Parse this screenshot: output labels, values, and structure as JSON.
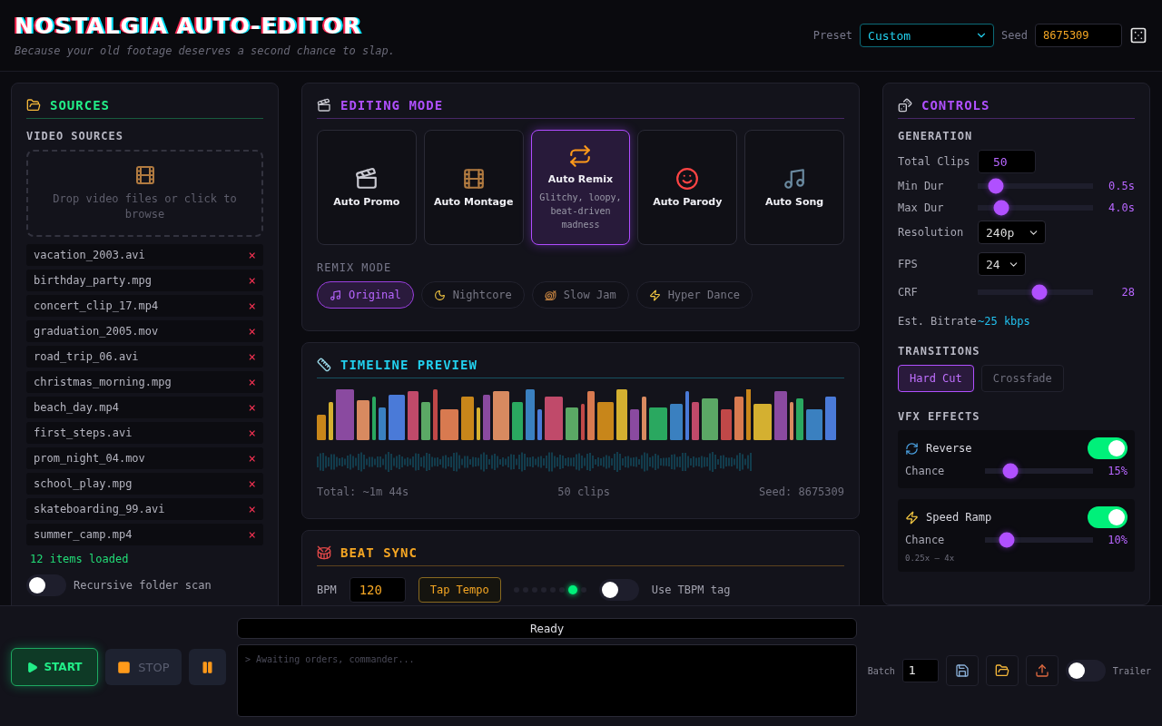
{
  "header": {
    "title": "NOSTALGIA AUTO-EDITOR",
    "subtitle": "Because your old footage deserves a second chance to slap.",
    "preset": {
      "label": "Preset",
      "value": "Custom"
    },
    "seed": {
      "label": "Seed",
      "value": "8675309"
    }
  },
  "sources": {
    "title": "SOURCES",
    "section": "VIDEO SOURCES",
    "dropzone": "Drop video files or click to browse",
    "files": [
      "vacation_2003.avi",
      "birthday_party.mpg",
      "concert_clip_17.mp4",
      "graduation_2005.mov",
      "road_trip_06.avi",
      "christmas_morning.mpg",
      "beach_day.mp4",
      "first_steps.avi",
      "prom_night_04.mov",
      "school_play.mpg",
      "skateboarding_99.avi",
      "summer_camp.mp4"
    ],
    "remove_mark": "×",
    "status": "12 items loaded",
    "recursive": {
      "label": "Recursive folder scan",
      "on": false
    }
  },
  "editing_mode": {
    "title": "EDITING MODE",
    "modes": [
      {
        "kind": "promo",
        "label": "Auto Promo",
        "selected": false
      },
      {
        "kind": "montage",
        "label": "Auto Montage",
        "selected": false
      },
      {
        "kind": "remix",
        "label": "Auto Remix",
        "description": "Glitchy, loopy, beat-driven madness",
        "selected": true
      },
      {
        "kind": "parody",
        "label": "Auto Parody",
        "selected": false
      },
      {
        "kind": "song",
        "label": "Auto Song",
        "selected": false
      }
    ],
    "remix_label": "REMIX MODE",
    "remix_options": [
      {
        "kind": "original",
        "label": "Original",
        "selected": true
      },
      {
        "kind": "nightcore",
        "label": "Nightcore",
        "selected": false
      },
      {
        "kind": "slow",
        "label": "Slow Jam",
        "selected": false
      },
      {
        "kind": "hyper",
        "label": "Hyper Dance",
        "selected": false
      }
    ]
  },
  "timeline": {
    "title": "TIMELINE PREVIEW",
    "total": "Total: ~1m 44s",
    "clips": "50 clips",
    "seed": "Seed: 8675309"
  },
  "beat_sync": {
    "title": "BEAT SYNC",
    "bpm_label": "BPM",
    "bpm": "120",
    "tap": "Tap Tempo",
    "tbpm": {
      "label": "Use TBPM tag",
      "on": false
    }
  },
  "controls": {
    "title": "CONTROLS",
    "generation": "GENERATION",
    "total_clips": {
      "label": "Total Clips",
      "value": "50"
    },
    "sliders": [
      {
        "label": "Min Dur",
        "level": 0.1,
        "reading": "0.5s"
      },
      {
        "label": "Max Dur",
        "level": 0.16,
        "reading": "4.0s"
      }
    ],
    "resolution": {
      "label": "Resolution",
      "value": "240p"
    },
    "fps": {
      "label": "FPS",
      "value": "24"
    },
    "crf": {
      "label": "CRF",
      "level": 0.54,
      "reading": "28"
    },
    "bitrate": {
      "label": "Est. Bitrate",
      "value": "~25 kbps"
    },
    "transitions_label": "TRANSITIONS",
    "transitions": [
      {
        "label": "Hard Cut",
        "selected": true
      },
      {
        "label": "Crossfade",
        "selected": false
      }
    ],
    "vfx_label": "VFX EFFECTS",
    "effects": [
      {
        "kind": "reverse",
        "name": "Reverse",
        "on": true,
        "chance_label": "Chance",
        "level": 0.19,
        "reading": "15%"
      },
      {
        "kind": "speed",
        "name": "Speed Ramp",
        "on": true,
        "chance_label": "Chance",
        "level": 0.15,
        "reading": "10%",
        "note": "0.25x – 4x"
      }
    ]
  },
  "bottom": {
    "start": "START",
    "stop": "STOP",
    "status": "Ready",
    "log": "> Awaiting orders, commander...",
    "batch": {
      "label": "Batch",
      "value": "1"
    },
    "trailer": {
      "label": "Trailer",
      "on": false
    }
  }
}
